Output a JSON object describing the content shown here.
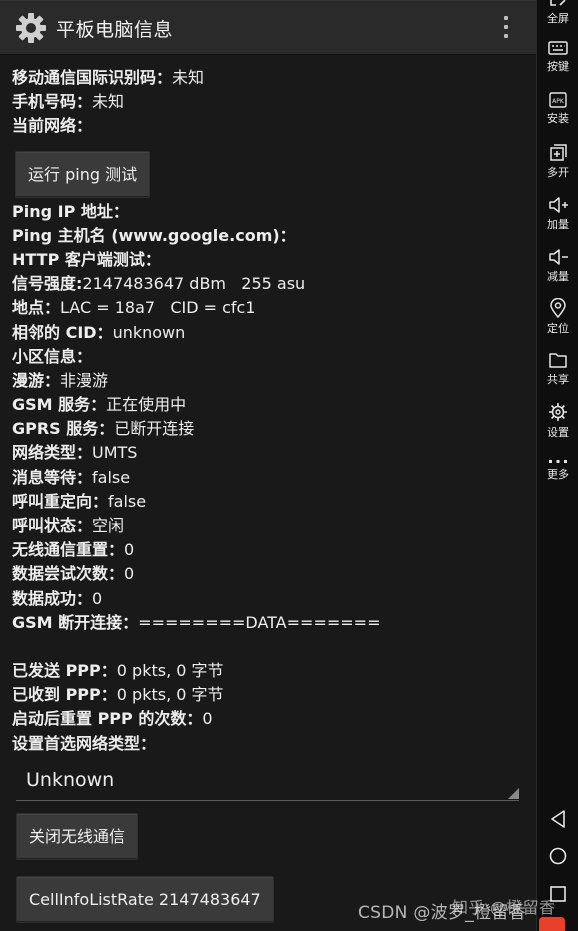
{
  "actionbar": {
    "title": "平板电脑信息",
    "app_icon": "gear-icon",
    "overflow_icon": "more-vertical-icon"
  },
  "rows_top": [
    {
      "label": "移动通信国际识别码：",
      "value": "未知"
    },
    {
      "label": "手机号码：",
      "value": "未知"
    },
    {
      "label": "当前网络：",
      "value": ""
    }
  ],
  "ping_button": "运行 ping 测试",
  "rows_main": [
    {
      "label": "Ping IP 地址：",
      "value": ""
    },
    {
      "label": "Ping 主机名 (www.google.com)：",
      "value": ""
    },
    {
      "label": "HTTP 客户端测试：",
      "value": ""
    },
    {
      "label": "信号强度:",
      "value": "2147483647 dBm   255 asu"
    },
    {
      "label": "地点：",
      "value": "LAC = 18a7   CID = cfc1"
    },
    {
      "label": "相邻的 CID：",
      "value": "unknown"
    },
    {
      "label": "小区信息：",
      "value": ""
    },
    {
      "label": "漫游：",
      "value": "非漫游"
    },
    {
      "label": "GSM 服务：",
      "value": "正在使用中"
    },
    {
      "label": "GPRS 服务：",
      "value": "已断开连接"
    },
    {
      "label": "网络类型：",
      "value": "UMTS"
    },
    {
      "label": "消息等待：",
      "value": "false"
    },
    {
      "label": "呼叫重定向：",
      "value": "false"
    },
    {
      "label": "呼叫状态：",
      "value": "空闲"
    },
    {
      "label": "无线通信重置：",
      "value": "0"
    },
    {
      "label": "数据尝试次数：",
      "value": "0"
    },
    {
      "label": "数据成功：",
      "value": "0"
    },
    {
      "label": "GSM 断开连接：",
      "value": "========DATA======="
    }
  ],
  "rows_ppp": [
    {
      "label": "已发送 PPP：",
      "value": "0 pkts, 0 字节"
    },
    {
      "label": "已收到 PPP：",
      "value": "0 pkts, 0 字节"
    },
    {
      "label": "启动后重置 PPP 的次数：",
      "value": "0"
    },
    {
      "label": "设置首选网络类型：",
      "value": ""
    }
  ],
  "network_type_spinner": {
    "selected": "Unknown"
  },
  "radio_button": "关闭无线通信",
  "cellinfo_button": "CellInfoListRate 2147483647",
  "sidebar": {
    "items": [
      {
        "label": "全屏",
        "icon": "fullscreen-icon"
      },
      {
        "label": "按键",
        "icon": "keyboard-icon"
      },
      {
        "label": "安装",
        "icon": "apk-install-icon"
      },
      {
        "label": "多开",
        "icon": "multi-instance-icon"
      },
      {
        "label": "加量",
        "icon": "volume-up-icon"
      },
      {
        "label": "减量",
        "icon": "volume-down-icon"
      },
      {
        "label": "定位",
        "icon": "location-pin-icon"
      },
      {
        "label": "共享",
        "icon": "folder-icon"
      },
      {
        "label": "设置",
        "icon": "gear-icon"
      },
      {
        "label": "更多",
        "icon": "more-horizontal-icon"
      }
    ],
    "nav": [
      "back-icon",
      "home-icon",
      "recents-icon"
    ]
  },
  "watermark": "CSDN @波罗_橙留香",
  "watermark_overlay": "知乎 @橙留香",
  "colors": {
    "background": "#191919",
    "actionbar": "#2a2a2a",
    "button": "#3a3a3a",
    "sidebar": "#0e0e0e",
    "badge": "#e8402a"
  }
}
